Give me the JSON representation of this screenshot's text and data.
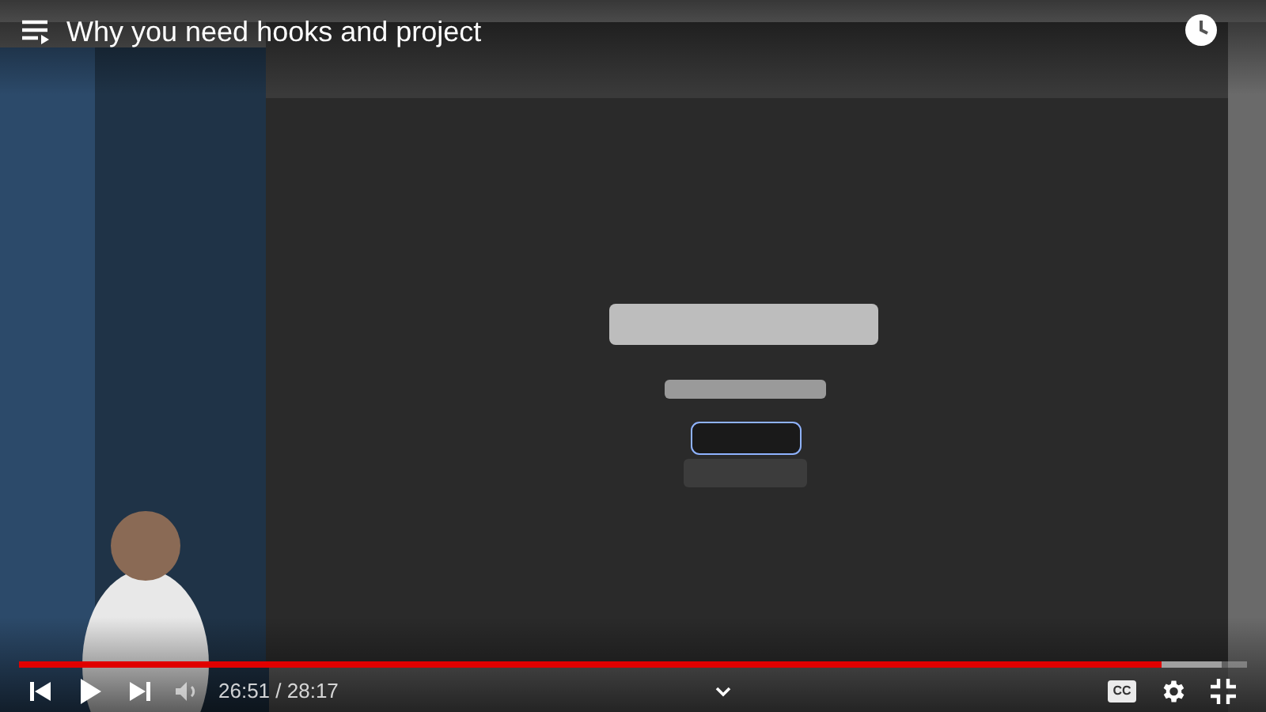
{
  "title": "Why you need hooks and project",
  "player": {
    "paused": true,
    "time": "26:51 / 28:17",
    "progress": {
      "level": 0.949
    },
    "captions": false,
    "captions_label": "CC"
  }
}
